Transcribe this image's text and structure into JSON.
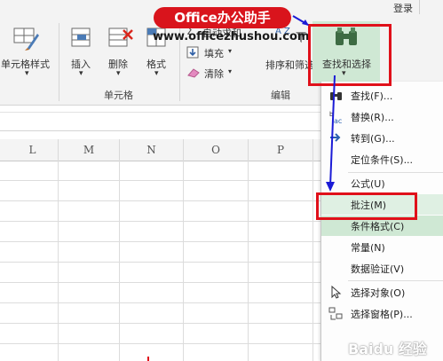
{
  "header": {
    "login": "登录"
  },
  "watermark": {
    "badge": "Office办公助手",
    "url": "www.officezhushou.com"
  },
  "ribbon": {
    "cells_group": {
      "label": "单元格",
      "buttons": [
        {
          "label": "单元格样式",
          "arrow": "▾"
        },
        {
          "label": "插入",
          "arrow": "▾"
        },
        {
          "label": "删除",
          "arrow": "▾"
        },
        {
          "label": "格式",
          "arrow": "▾"
        }
      ]
    },
    "edit_group": {
      "label": "编辑",
      "autosum": "自动求和",
      "fill": "填充",
      "clear": "清除",
      "sort_filter": "排序和筛选",
      "find_select": "查找和选择",
      "sigma": "Σ",
      "az": "A Z"
    }
  },
  "sheet": {
    "columns": [
      "L",
      "M",
      "N",
      "O",
      "P"
    ]
  },
  "menu": {
    "items": [
      {
        "label": "查找(F)...",
        "icon": "binoculars-icon"
      },
      {
        "label": "替换(R)...",
        "icon": "replace-icon"
      },
      {
        "label": "转到(G)...",
        "icon": "arrow-right-icon"
      },
      {
        "label": "定位条件(S)...",
        "icon": ""
      },
      {
        "label": "公式(U)",
        "icon": ""
      },
      {
        "label": "批注(M)",
        "icon": ""
      },
      {
        "label": "条件格式(C)",
        "icon": ""
      },
      {
        "label": "常量(N)",
        "icon": ""
      },
      {
        "label": "数据验证(V)",
        "icon": ""
      },
      {
        "label": "选择对象(O)",
        "icon": "cursor-icon"
      },
      {
        "label": "选择窗格(P)...",
        "icon": "selection-pane-icon"
      }
    ]
  },
  "colors": {
    "highlight_red": "#e0101a",
    "arrow_blue": "#1b1bd6",
    "selected_green": "#cfe8d4",
    "hover_green": "#dff0e3"
  },
  "footer_watermark": "Baidu 经验"
}
